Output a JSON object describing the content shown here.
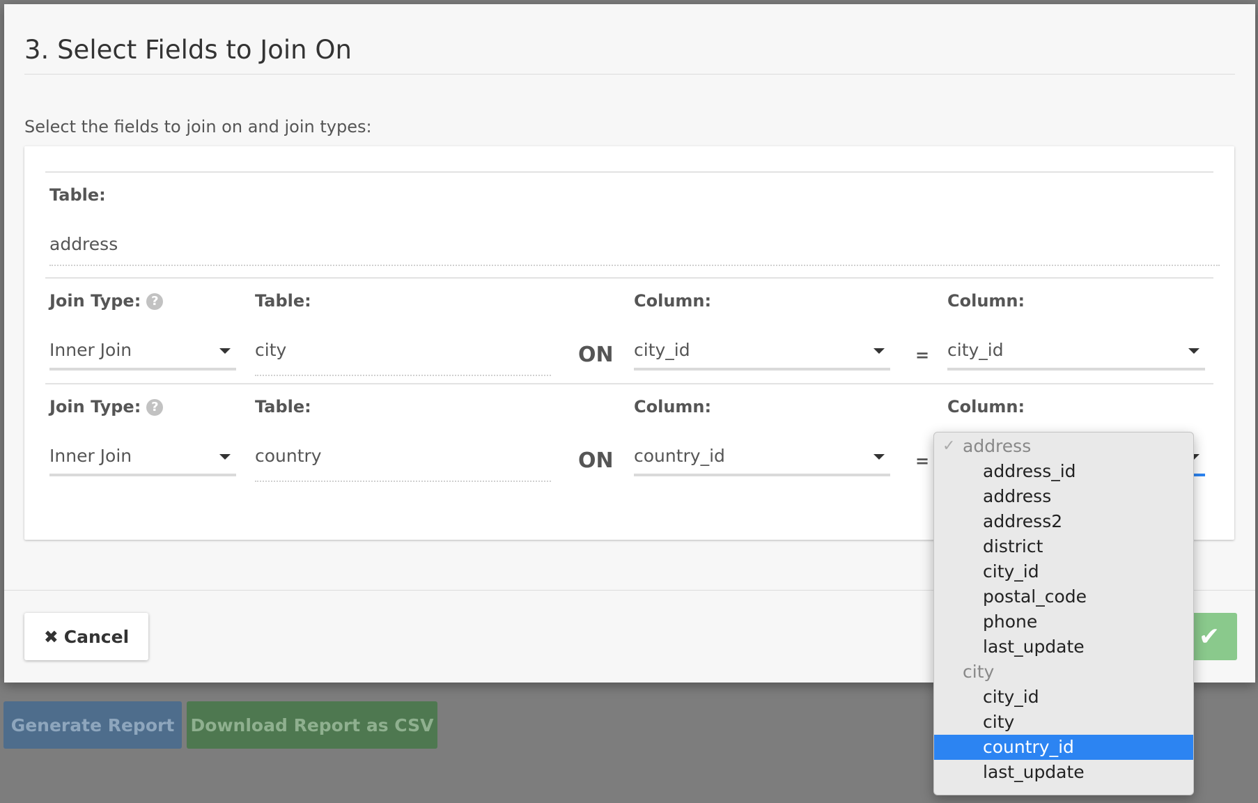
{
  "background": {
    "generate_button": "Generate Report",
    "download_button": "Download Report as CSV"
  },
  "modal": {
    "title": "3. Select Fields to Join On",
    "instructions": "Select the fields to join on and join types:",
    "base_table": {
      "label": "Table:",
      "value": "address"
    },
    "joins": [
      {
        "join_type_label": "Join Type:",
        "join_type_value": "Inner Join",
        "table_label": "Table:",
        "table_value": "city",
        "on_text": "ON",
        "column_left_label": "Column:",
        "column_left_value": "city_id",
        "equals": "=",
        "column_right_label": "Column:",
        "column_right_value": "city_id"
      },
      {
        "join_type_label": "Join Type:",
        "join_type_value": "Inner Join",
        "table_label": "Table:",
        "table_value": "country",
        "on_text": "ON",
        "column_left_label": "Column:",
        "column_left_value": "country_id",
        "equals": "=",
        "column_right_label": "Column:",
        "column_right_value": ""
      }
    ],
    "cancel_label": "Cancel",
    "help_icon": "question-circle-icon",
    "confirm_icon": "check-icon"
  },
  "dropdown": {
    "check_mark": "✓",
    "groups": [
      {
        "label": "address",
        "options": [
          "address_id",
          "address",
          "address2",
          "district",
          "city_id",
          "postal_code",
          "phone",
          "last_update"
        ]
      },
      {
        "label": "city",
        "options": [
          "city_id",
          "city",
          "country_id",
          "last_update"
        ]
      }
    ],
    "selected": "country_id",
    "selected_color": "#2c84f2"
  }
}
